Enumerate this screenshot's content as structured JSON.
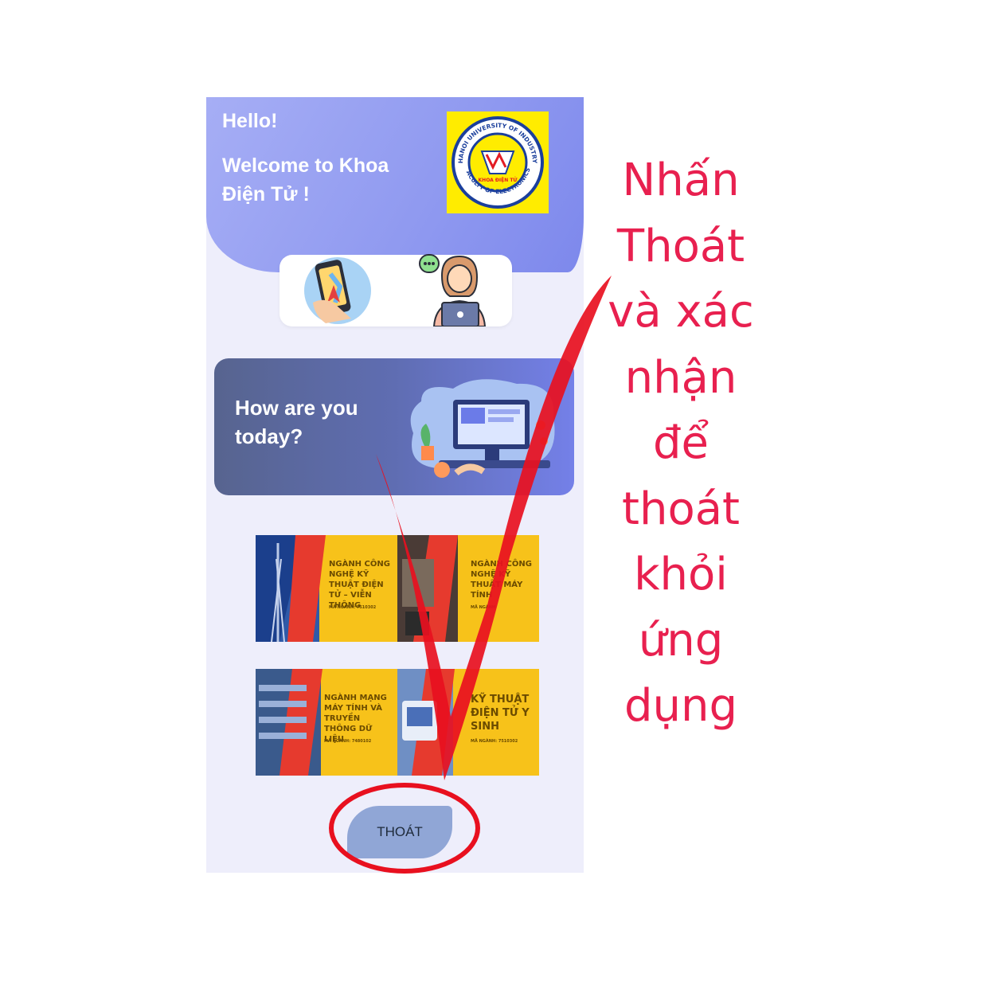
{
  "header": {
    "greeting": "Hello!",
    "welcome": "Welcome to Khoa Điện Tử !"
  },
  "logo": {
    "arc_top": "HANOI UNIVERSITY OF INDUSTRY",
    "arc_bottom": "FACULTY OF ELECTRONICS",
    "center": "KHOA ĐIỆN TỬ"
  },
  "mood_card": {
    "text": "How are you today?"
  },
  "banners": [
    {
      "title": "NGÀNH CÔNG NGHỆ KỸ THUẬT ĐIỆN TỬ – VIỄN THÔNG",
      "code": "MÃ NGÀNH: 7510302"
    },
    {
      "title": "NGÀNH CÔNG NGHỆ KỸ THUẬT MÁY TÍNH",
      "code": "MÃ NGÀNH"
    },
    {
      "title": "NGÀNH MẠNG MÁY TÍNH VÀ TRUYỀN THÔNG DỮ LIỆU",
      "code": "MÃ NGÀNH: 7480102"
    },
    {
      "title": "KỸ THUẬT ĐIỆN TỬ Y SINH",
      "code": "MÃ NGÀNH: 7510302"
    }
  ],
  "exit_button": {
    "label": "THOÁT"
  },
  "annotation": {
    "text": "Nhấn Thoát và xác nhận để thoát khỏi ứng dụng",
    "color": "#e8204f",
    "arrow_color": "#e8101f"
  }
}
